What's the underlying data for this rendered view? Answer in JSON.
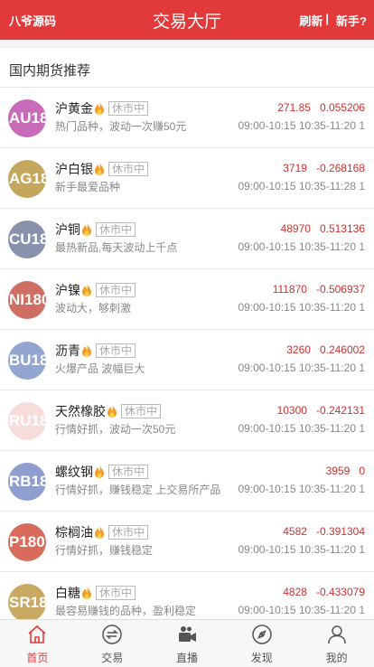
{
  "header": {
    "brand": "八爷源码",
    "title": "交易大厅",
    "refresh": "刷新",
    "separator": "|",
    "help": "新手?"
  },
  "section_title": "国内期货推荐",
  "colors": {
    "accent": "#e23a3a",
    "price": "#d0302f"
  },
  "items": [
    {
      "avatar": "AU18",
      "avatar_color": "#c86bb8",
      "name": "沪黄金",
      "status": "休市中",
      "desc": "热门品种，波动一次赚50元",
      "price": "271.85",
      "change": "0.055206",
      "hours": "09:00-10:15 10:35-11:20 1"
    },
    {
      "avatar": "AG18",
      "avatar_color": "#c4a65d",
      "name": "沪白银",
      "status": "休市中",
      "desc": "新手最爱品种",
      "price": "3719",
      "change": "-0.268168",
      "hours": "09:00-10:15 10:35-11:28 1"
    },
    {
      "avatar": "CU18",
      "avatar_color": "#8a91ad",
      "name": "沪铜",
      "status": "休市中",
      "desc": "最热新品,每天波动上千点",
      "price": "48970",
      "change": "0.513136",
      "hours": "09:00-10:15 10:35-11:20 1"
    },
    {
      "avatar": "NI180",
      "avatar_color": "#cf6f63",
      "name": "沪镍",
      "status": "休市中",
      "desc": "波动大，够刺激",
      "price": "111870",
      "change": "-0.506937",
      "hours": "09:00-10:15 10:35-11:20 1"
    },
    {
      "avatar": "BU18",
      "avatar_color": "#93a6d0",
      "name": "沥青",
      "status": "休市中",
      "desc": "火爆产品 波幅巨大",
      "price": "3260",
      "change": "0.246002",
      "hours": "09:00-10:15 10:35-11:20 1"
    },
    {
      "avatar": "RU18",
      "avatar_color": "#f7dcdc",
      "name": "天然橡胶",
      "status": "休市中",
      "desc": "行情好抓，波动一次50元",
      "price": "10300",
      "change": "-0.242131",
      "hours": "09:00-10:15 10:35-11:20 1"
    },
    {
      "avatar": "RB18",
      "avatar_color": "#8e9ecf",
      "name": "螺纹钢",
      "status": "休市中",
      "desc": "行情好抓，赚钱稳定 上交易所产品",
      "price": "3959",
      "change": "0",
      "hours": "09:00-10:15 10:35-11:20 1"
    },
    {
      "avatar": "P180",
      "avatar_color": "#d86b5c",
      "name": "棕榈油",
      "status": "休市中",
      "desc": "行情好抓，赚钱稳定",
      "price": "4582",
      "change": "-0.391304",
      "hours": "09:00-10:15 10:35-11:20 1"
    },
    {
      "avatar": "SR18",
      "avatar_color": "#c9a861",
      "name": "白糖",
      "status": "休市中",
      "desc": "最容易赚钱的品种，盈利稳定",
      "price": "4828",
      "change": "-0.433079",
      "hours": "09:00-10:15 10:35-11:20 1"
    }
  ],
  "tabs": [
    {
      "label": "首页",
      "icon": "home-icon",
      "active": true
    },
    {
      "label": "交易",
      "icon": "exchange-icon",
      "active": false
    },
    {
      "label": "直播",
      "icon": "camera-icon",
      "active": false
    },
    {
      "label": "发现",
      "icon": "compass-icon",
      "active": false
    },
    {
      "label": "我的",
      "icon": "user-icon",
      "active": false
    }
  ]
}
